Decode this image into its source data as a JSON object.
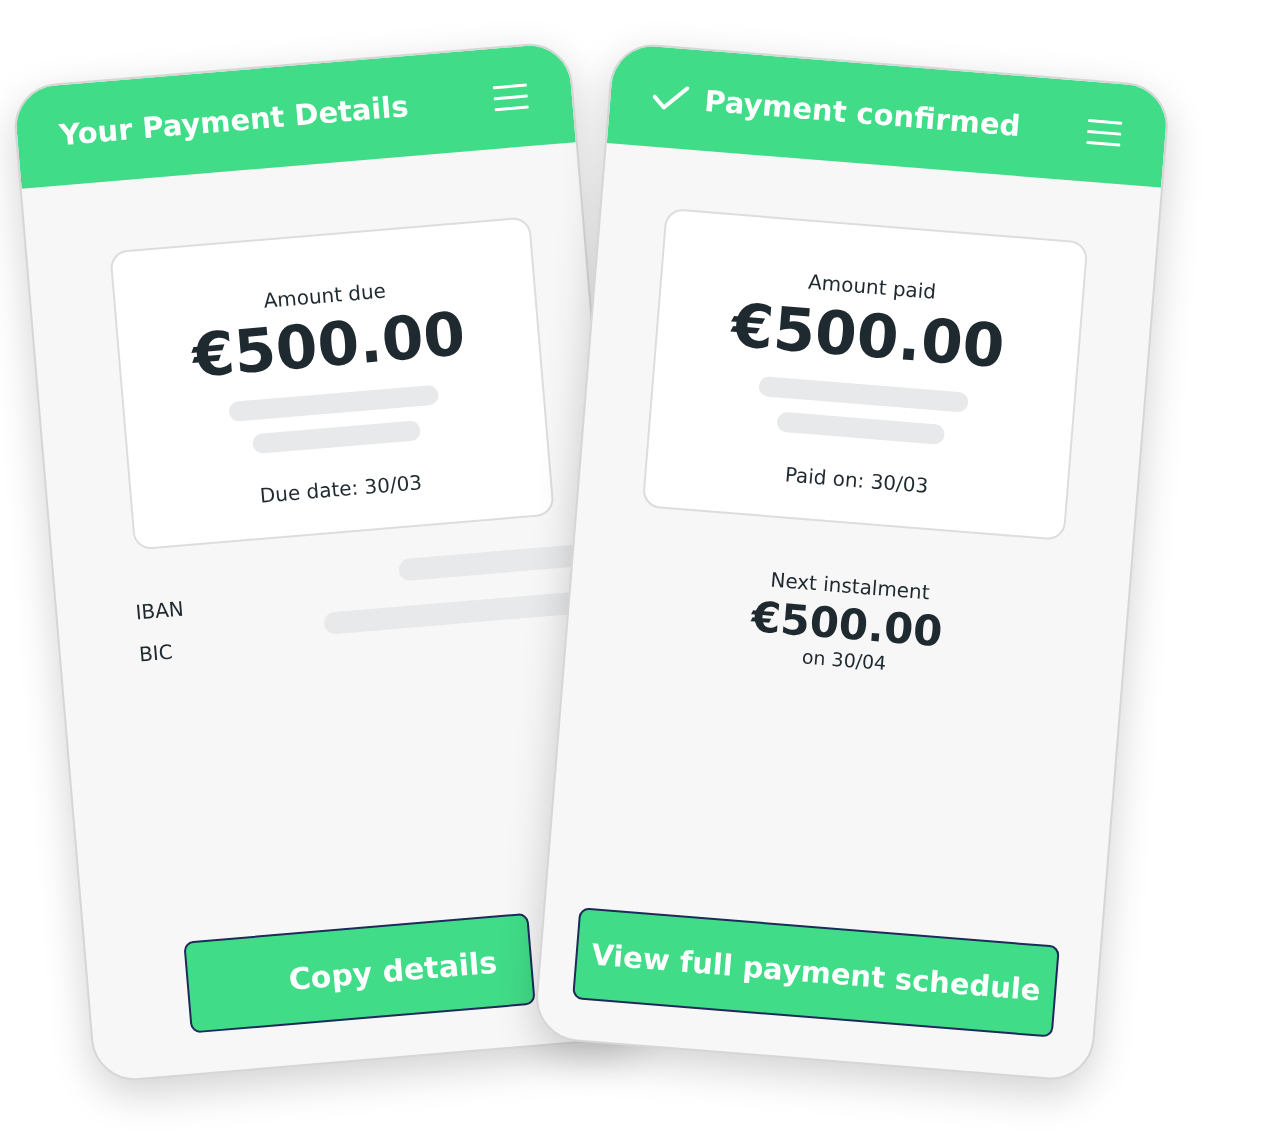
{
  "left_screen": {
    "title": "Your Payment Details",
    "amount_card": {
      "label": "Amount due",
      "amount": "€500.00",
      "detail": "Due date: 30/03"
    },
    "bank_fields": [
      {
        "label": "IBAN"
      },
      {
        "label": "BIC"
      }
    ],
    "button": "Copy details"
  },
  "right_screen": {
    "title": "Payment confirmed",
    "amount_card": {
      "label": "Amount paid",
      "amount": "€500.00",
      "detail": "Paid on: 30/03"
    },
    "next_instalment": {
      "label": "Next instalment",
      "amount": "€500.00",
      "date": "on 30/04"
    },
    "button": "View full payment schedule"
  }
}
